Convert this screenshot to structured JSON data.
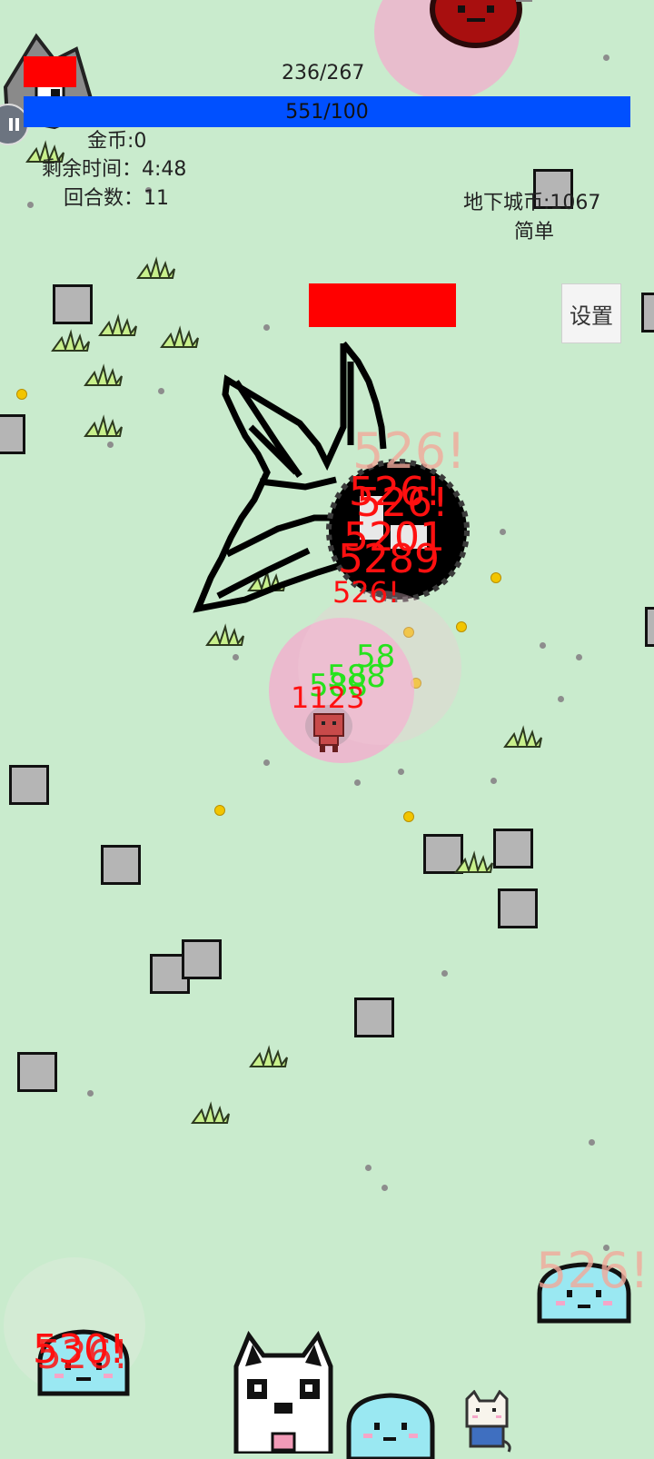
{
  "hud": {
    "player_hp": "236/267",
    "xp": "551/100",
    "coins": "金币:0",
    "time_remaining": "剩余时间：4:48",
    "round": "回合数：11",
    "dungeon_coins": "地下城币:1067",
    "difficulty": "简单",
    "settings_label": "设置"
  },
  "damage_numbers": {
    "boss_faded": "526!",
    "boss_a": "526!",
    "boss_b": "5201",
    "boss_c": "5289",
    "boss_d": "526!",
    "player_hit": "1123",
    "heal_a": "58",
    "heal_b": "588",
    "right_faded": "526!",
    "left_bottom_a": "530!",
    "left_bottom_b": "526!"
  },
  "icons": {
    "boss": "black-winged-orb-boss",
    "player": "red-hero-icon",
    "enemy_slime": "cyan-slime-icon",
    "enemy_dog": "husky-dog-icon",
    "enemy_cat": "cat-enemy-icon",
    "enemy_red": "red-blob-enemy-icon",
    "pause": "pause-icon"
  },
  "colors": {
    "background": "#c9ebcd",
    "hp_bar": "#ff0000",
    "xp_bar": "#0050ff",
    "damage": "#ff1010",
    "heal": "#27e21d"
  }
}
